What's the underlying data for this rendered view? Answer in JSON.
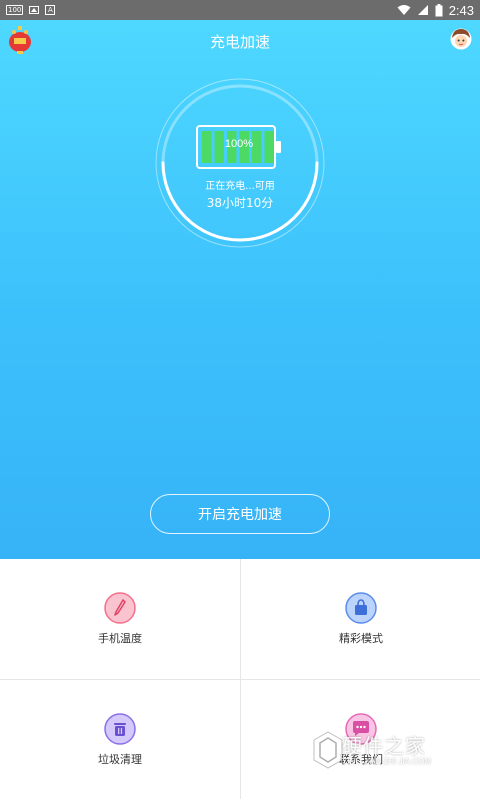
{
  "status_bar": {
    "badge": "100",
    "letter_icon": "A",
    "time": "2:43"
  },
  "header": {
    "title": "充电加速"
  },
  "battery": {
    "percent_label": "100%",
    "level": 1.0,
    "status": "正在充电...可用",
    "remaining": "38小时10分",
    "progress": 0.5
  },
  "boost_button": {
    "label": "开启充电加速"
  },
  "tools": [
    {
      "label": "手机温度",
      "icon": "thermometer-icon",
      "color": "#f56f8c"
    },
    {
      "label": "精彩模式",
      "icon": "bag-icon",
      "color": "#5a8cf0"
    },
    {
      "label": "垃圾清理",
      "icon": "trash-icon",
      "color": "#8a6fe8"
    },
    {
      "label": "联系我们",
      "icon": "chat-icon",
      "color": "#e86ab8"
    }
  ],
  "watermark": {
    "name": "硬件之家",
    "sub": "YING JIAN ZHI JIA.COM"
  },
  "colors": {
    "hero_top": "#4ed8ff",
    "hero_bottom": "#36b3f7",
    "battery_fill": "#4cd964"
  }
}
